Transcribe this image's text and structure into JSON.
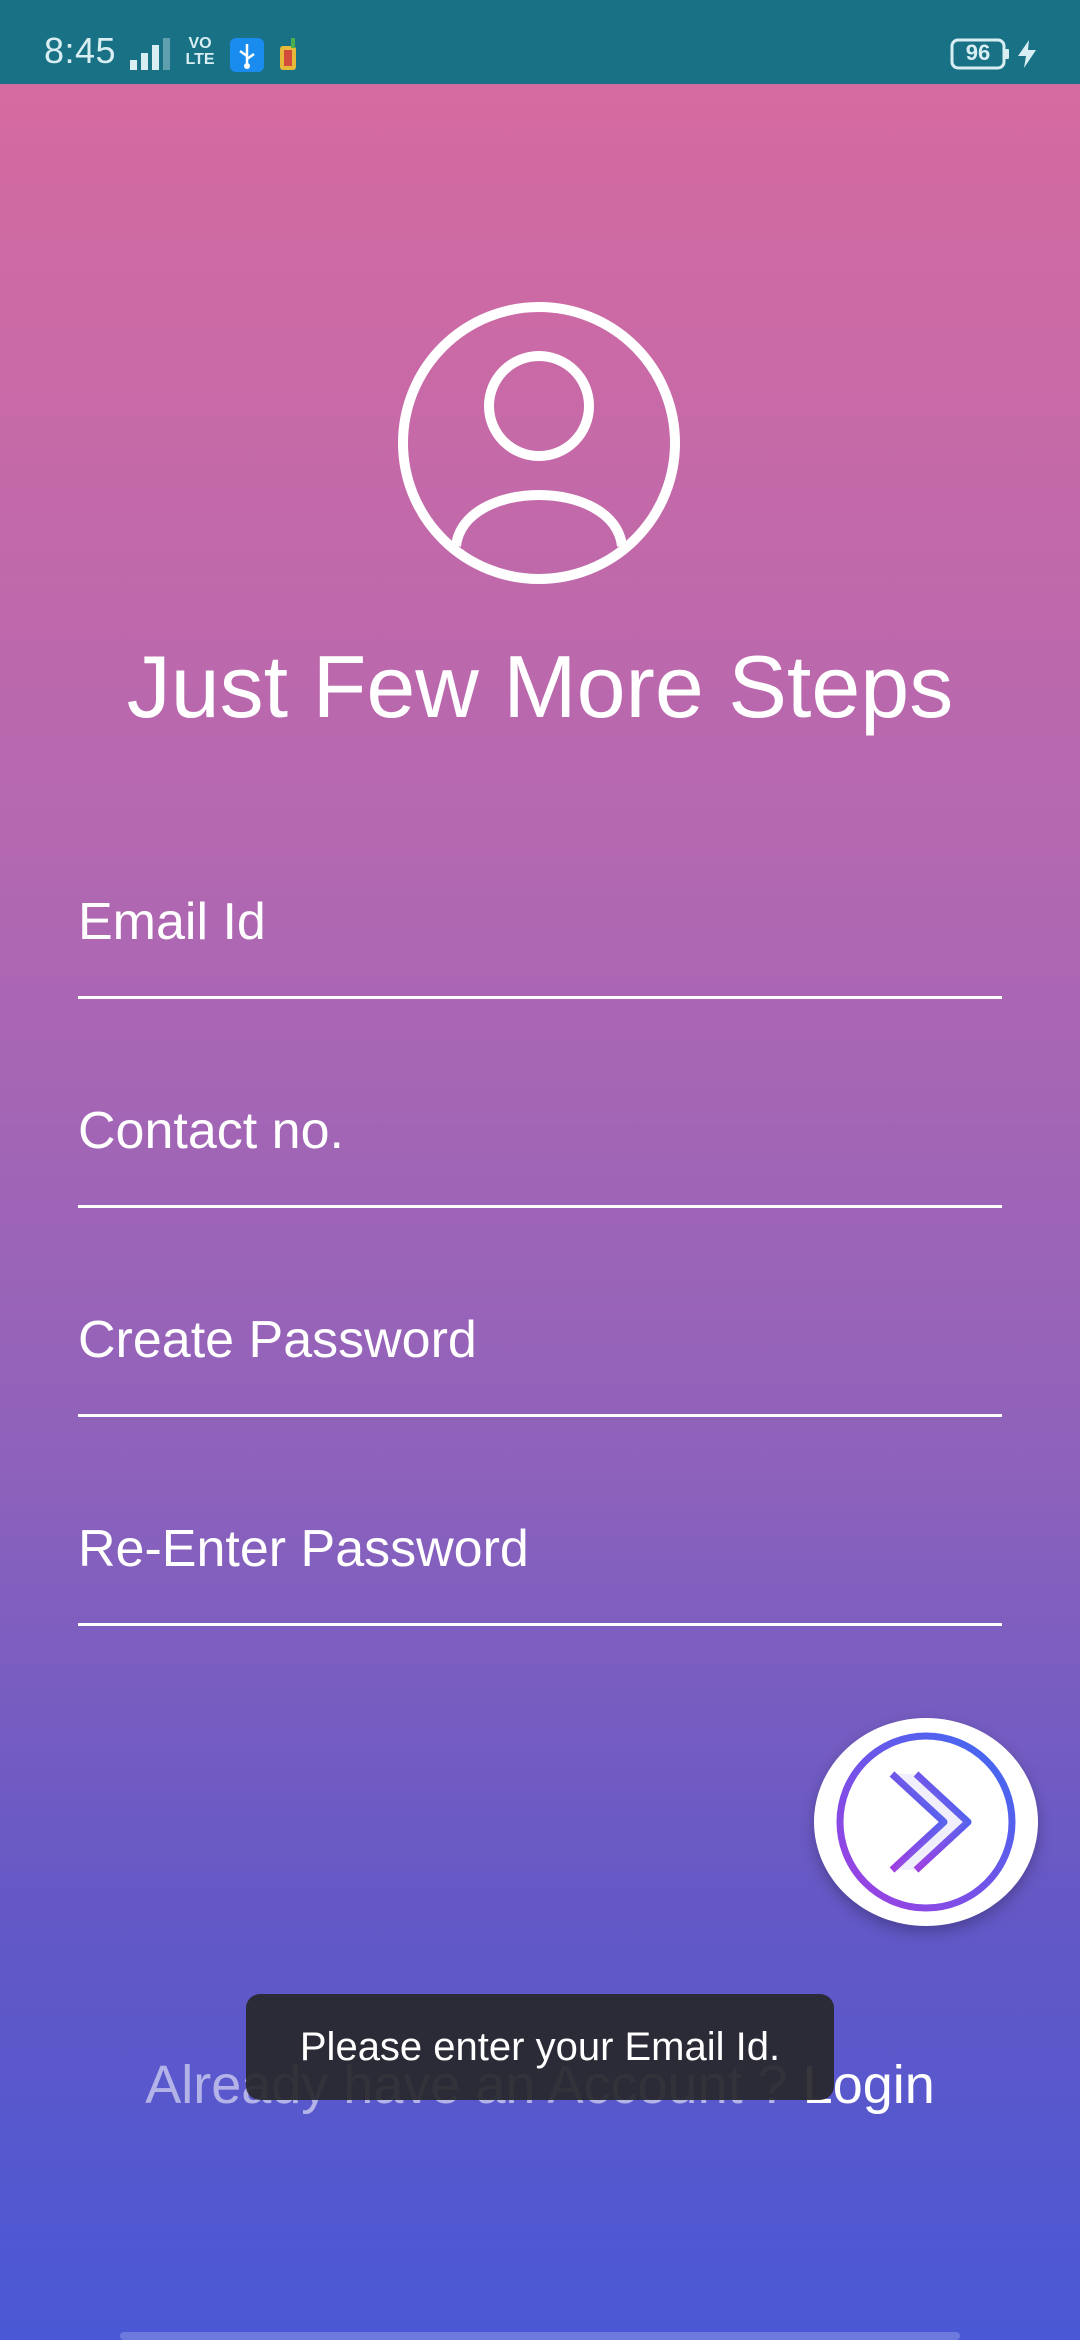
{
  "status_bar": {
    "time": "8:45",
    "network_label": "VO LTE",
    "battery": "96",
    "icons": [
      "signal-icon",
      "volte-icon",
      "usb-icon",
      "app-notification-icon",
      "battery-icon",
      "charging-bolt-icon"
    ]
  },
  "header": {
    "avatar_icon": "user-circle-icon",
    "title": "Just Few More Steps"
  },
  "form": {
    "email_placeholder": "Email Id",
    "contact_placeholder": "Contact no.",
    "password_placeholder": "Create Password",
    "reenter_password_placeholder": "Re-Enter Password",
    "next_icon": "double-chevron-right-icon"
  },
  "footer": {
    "prompt": "Already have an Account ?",
    "login_label": "Login"
  },
  "toast": {
    "message": "Please enter your Email Id."
  },
  "colors": {
    "status_bar": "#197186",
    "gradient_top": "#d96b9e",
    "gradient_bottom": "#4a58d5",
    "fab_ring_start": "#a23ee0",
    "fab_ring_end": "#3b6cf2"
  }
}
